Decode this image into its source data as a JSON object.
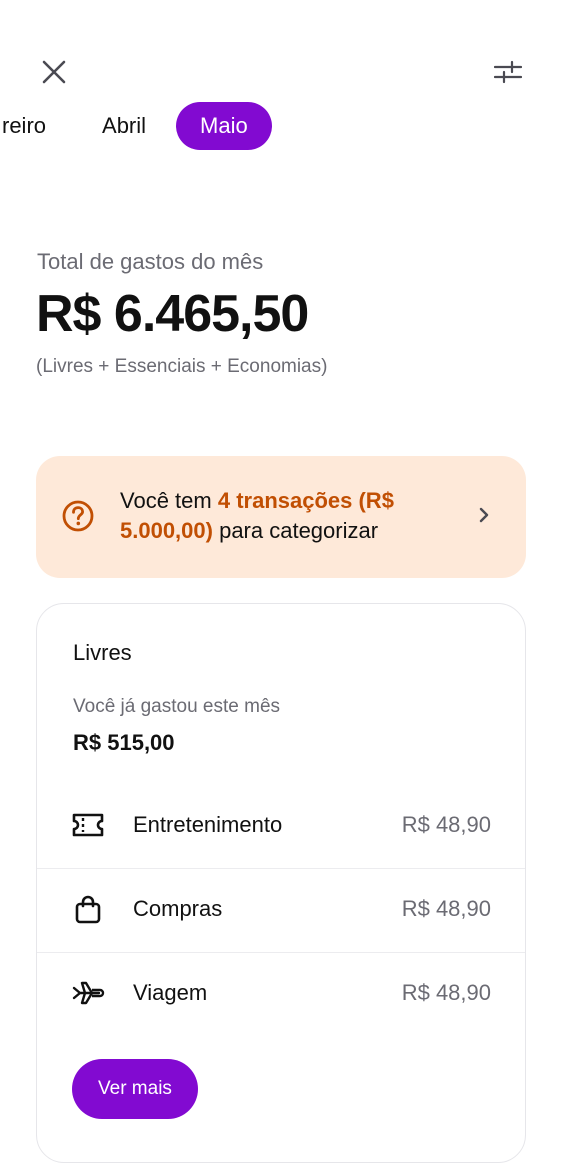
{
  "header": {
    "close_icon": "close-icon",
    "filter_icon": "sliders-icon"
  },
  "months": [
    {
      "label": "reiro",
      "active": false
    },
    {
      "label": "Abril",
      "active": false
    },
    {
      "label": "Maio",
      "active": true
    }
  ],
  "summary": {
    "label": "Total de gastos do mês",
    "amount": "R$ 6.465,50",
    "note": "(Livres + Essenciais + Economias)"
  },
  "alert": {
    "icon": "question-icon",
    "prefix": "Você tem ",
    "highlight": "4 transações (R$ 5.000,00)",
    "suffix": " para categorizar",
    "chevron": "chevron-right-icon"
  },
  "card": {
    "title": "Livres",
    "subtitle": "Você já gastou este mês",
    "spent": "R$ 515,00",
    "categories": [
      {
        "name": "Entretenimento",
        "value": "R$ 48,90",
        "icon": "ticket-icon"
      },
      {
        "name": "Compras",
        "value": "R$ 48,90",
        "icon": "shopping-bag-icon"
      },
      {
        "name": "Viagem",
        "value": "R$ 48,90",
        "icon": "airplane-icon"
      }
    ],
    "more_label": "Ver mais"
  },
  "colors": {
    "accent": "#820ad1",
    "alert_bg": "#fee9d9",
    "alert_text": "#c14f03",
    "muted": "#6b6b73"
  }
}
